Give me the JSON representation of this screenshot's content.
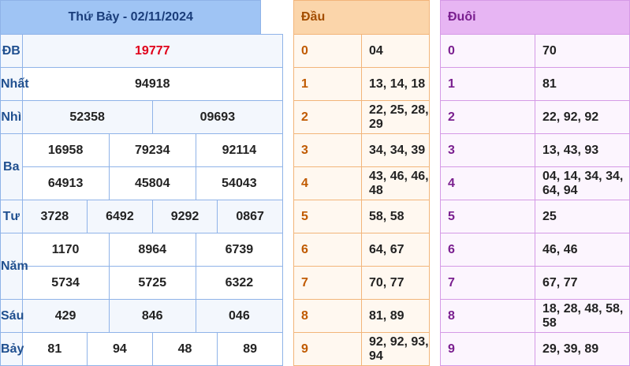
{
  "main": {
    "title": "Thứ Bảy - 02/11/2024",
    "rows": {
      "db": {
        "label": "ĐB",
        "values": [
          "19777"
        ]
      },
      "nhat": {
        "label": "Nhất",
        "values": [
          "94918"
        ]
      },
      "nhi": {
        "label": "Nhì",
        "values": [
          "52358",
          "09693"
        ]
      },
      "ba": {
        "label": "Ba",
        "values": [
          "16958",
          "79234",
          "92114",
          "64913",
          "45804",
          "54043"
        ]
      },
      "tu": {
        "label": "Tư",
        "values": [
          "3728",
          "6492",
          "9292",
          "0867"
        ]
      },
      "nam": {
        "label": "Năm",
        "values": [
          "1170",
          "8964",
          "6739",
          "5734",
          "5725",
          "6322"
        ]
      },
      "sau": {
        "label": "Sáu",
        "values": [
          "429",
          "846",
          "046"
        ]
      },
      "bay": {
        "label": "Bảy",
        "values": [
          "81",
          "94",
          "48",
          "89"
        ]
      }
    }
  },
  "dau": {
    "header": "Đầu",
    "rows": [
      {
        "k": "0",
        "v": "04"
      },
      {
        "k": "1",
        "v": "13, 14, 18"
      },
      {
        "k": "2",
        "v": "22, 25, 28, 29"
      },
      {
        "k": "3",
        "v": "34, 34, 39"
      },
      {
        "k": "4",
        "v": "43, 46, 46, 48"
      },
      {
        "k": "5",
        "v": "58, 58"
      },
      {
        "k": "6",
        "v": "64, 67"
      },
      {
        "k": "7",
        "v": "70, 77"
      },
      {
        "k": "8",
        "v": "81, 89"
      },
      {
        "k": "9",
        "v": "92, 92, 93, 94"
      }
    ]
  },
  "duoi": {
    "header": "Đuôi",
    "rows": [
      {
        "k": "0",
        "v": "70"
      },
      {
        "k": "1",
        "v": "81"
      },
      {
        "k": "2",
        "v": "22, 92, 92"
      },
      {
        "k": "3",
        "v": "13, 43, 93"
      },
      {
        "k": "4",
        "v": "04, 14, 34, 34, 64, 94"
      },
      {
        "k": "5",
        "v": "25"
      },
      {
        "k": "6",
        "v": "46, 46"
      },
      {
        "k": "7",
        "v": "67, 77"
      },
      {
        "k": "8",
        "v": "18, 28, 48, 58, 58"
      },
      {
        "k": "9",
        "v": "29, 39, 89"
      }
    ]
  }
}
